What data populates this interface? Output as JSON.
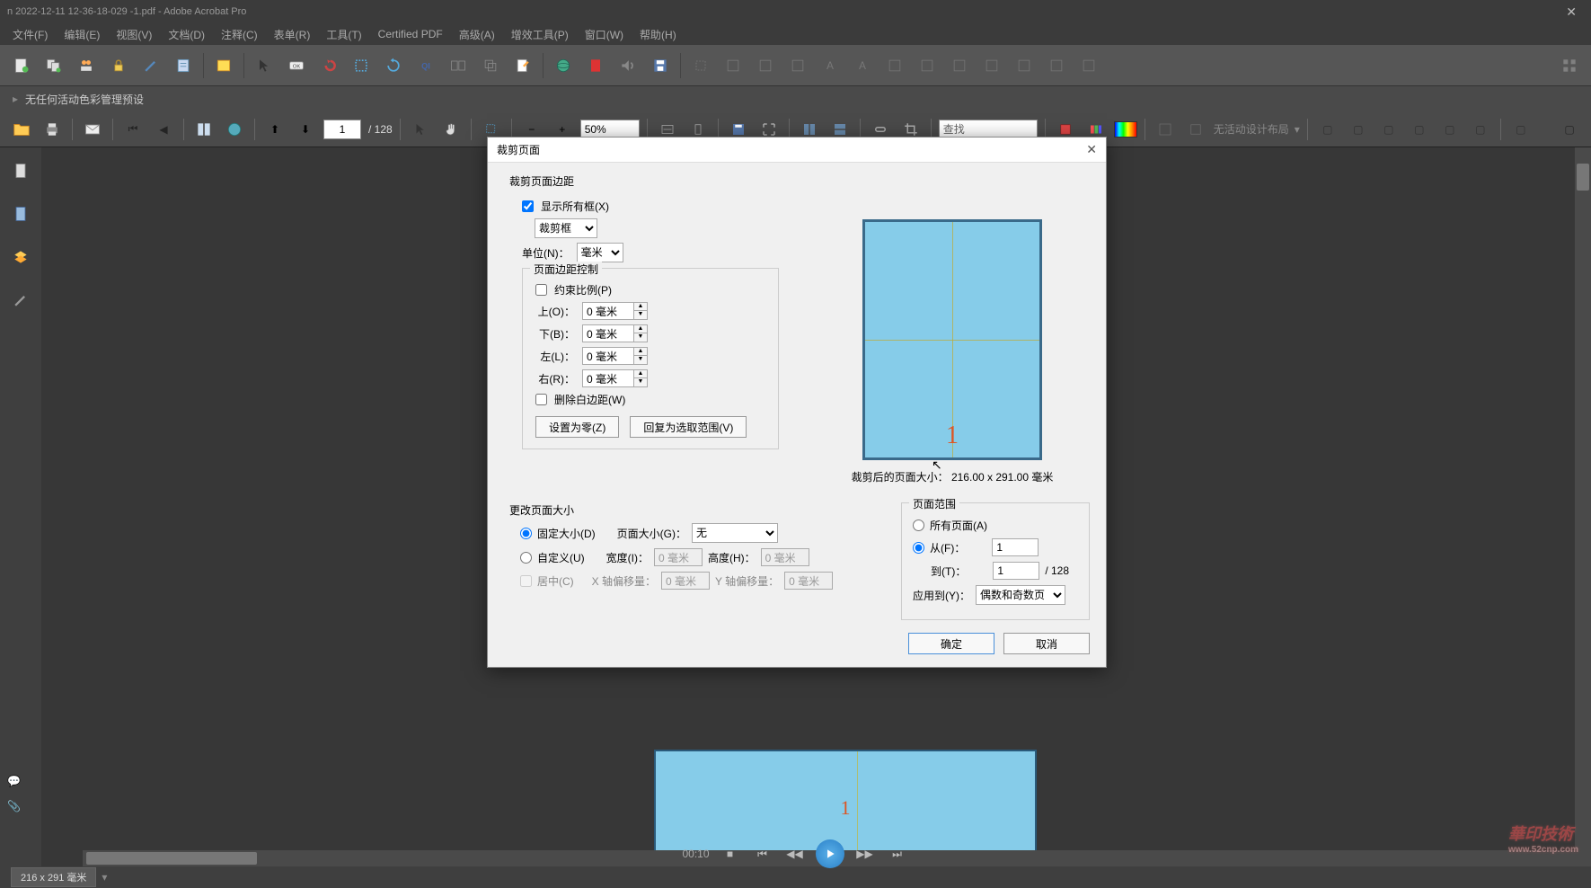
{
  "titlebar": {
    "text": "n 2022-12-11 12-36-18-029          -1.pdf - Adobe Acrobat Pro"
  },
  "menus": [
    "文件(F)",
    "编辑(E)",
    "视图(V)",
    "文档(D)",
    "注释(C)",
    "表单(R)",
    "工具(T)",
    "Certified PDF",
    "高级(A)",
    "增效工具(P)",
    "窗口(W)",
    "帮助(H)"
  ],
  "colorbar": {
    "label": "无任何活动色彩管理预设"
  },
  "nav": {
    "page_current": "1",
    "page_total": "/ 128",
    "zoom": "50%",
    "search_placeholder": "查找",
    "layout_label": "无活动设计布局"
  },
  "status": {
    "dimensions": "216 x 291 毫米"
  },
  "media": {
    "time": "00:10"
  },
  "dialog": {
    "title": "裁剪页面",
    "margins_title": "裁剪页面边距",
    "show_all_boxes": "显示所有框(X)",
    "crop_select": "裁剪框",
    "unit_label": "单位(N)：",
    "unit_value": "毫米",
    "margin_ctrl_title": "页面边距控制",
    "constrain": "约束比例(P)",
    "top_label": "上(O)：",
    "top_val": "0 毫米",
    "bottom_label": "下(B)：",
    "bottom_val": "0 毫米",
    "left_label": "左(L)：",
    "left_val": "0 毫米",
    "right_label": "右(R)：",
    "right_val": "0 毫米",
    "remove_white": "删除白边距(W)",
    "set_zero": "设置为零(Z)",
    "revert": "回复为选取范围(V)",
    "preview_size": "裁剪后的页面大小： 216.00 x 291.00 毫米",
    "preview_pg": "1",
    "change_size_title": "更改页面大小",
    "fixed_size": "固定大小(D)",
    "custom_size": "自定义(U)",
    "page_size_label": "页面大小(G)：",
    "page_size_val": "无",
    "width_label": "宽度(I)：",
    "width_val": "0 毫米",
    "height_label": "高度(H)：",
    "height_val": "0 毫米",
    "center": "居中(C)",
    "x_offset_label": "X 轴偏移量：",
    "x_offset_val": "0 毫米",
    "y_offset_label": "Y 轴偏移量：",
    "y_offset_val": "0 毫米",
    "range_title": "页面范围",
    "all_pages": "所有页面(A)",
    "from_label": "从(F)：",
    "from_val": "1",
    "to_label": "到(T)：",
    "to_val": "1",
    "to_total": "/ 128",
    "apply_to_label": "应用到(Y)：",
    "apply_to_val": "偶数和奇数页",
    "ok": "确定",
    "cancel": "取消"
  },
  "watermark": {
    "main": "華印技術",
    "sub": "www.52cnp.com"
  }
}
